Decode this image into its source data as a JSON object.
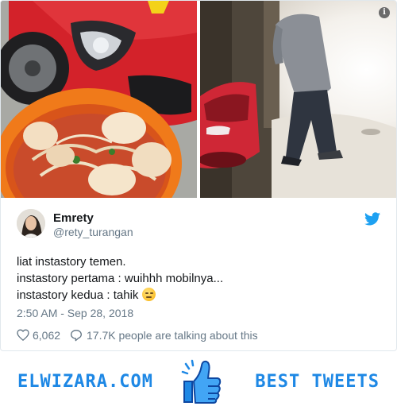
{
  "tweet": {
    "display_name": "Emrety",
    "handle": "@rety_turangan",
    "lines": [
      "liat instastory temen.",
      "instastory pertama : wuihhh mobilnya...",
      "instastory kedua : tahik"
    ],
    "emoji": "expressionless-face",
    "timestamp": "2:50 AM - Sep 28, 2018",
    "likes": "6,062",
    "talking": "17.7K people are talking about this",
    "info_icon_glyph": "i"
  },
  "icons": {
    "info": "info-icon",
    "brand": "twitter-bird-icon",
    "like": "heart-icon",
    "reply": "speech-bubble-icon",
    "thumb": "thumbs-up-icon"
  },
  "footer": {
    "left_brand": "ELWIZARA.COM",
    "right_brand": "BEST TWEETS"
  },
  "colors": {
    "twitter_blue": "#1da1f2",
    "footer_blue": "#1e88e5",
    "meta_gray": "#657786",
    "text": "#14171a"
  }
}
